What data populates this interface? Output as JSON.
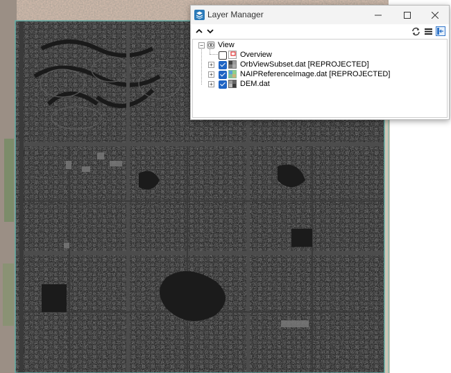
{
  "window": {
    "title": "Layer Manager",
    "icon": "layer-manager-app-icon",
    "controls": [
      "minimize",
      "maximize",
      "close"
    ]
  },
  "toolbar": {
    "left": [
      "collapse-up-icon",
      "expand-down-icon"
    ],
    "right": [
      "refresh-icon",
      "menu-icon",
      "dock-icon"
    ]
  },
  "tree": {
    "root": {
      "label": "View",
      "icon": "view-icon",
      "expanded": true
    },
    "layers": [
      {
        "label": "Overview",
        "checked": false,
        "icon": "overview-icon",
        "expandable": false
      },
      {
        "label": "OrbViewSubset.dat [REPROJECTED]",
        "checked": true,
        "icon": "raster-grayscale-icon",
        "expandable": true
      },
      {
        "label": "NAIPReferenceImage.dat [REPROJECTED]",
        "checked": true,
        "icon": "raster-color-icon",
        "expandable": true
      },
      {
        "label": "DEM.dat",
        "checked": true,
        "icon": "raster-grayscale-icon",
        "expandable": true
      }
    ]
  },
  "colors": {
    "accent": "#1f64c4",
    "imagery_dark": "#262626",
    "imagery_border": "#63b0a8"
  }
}
